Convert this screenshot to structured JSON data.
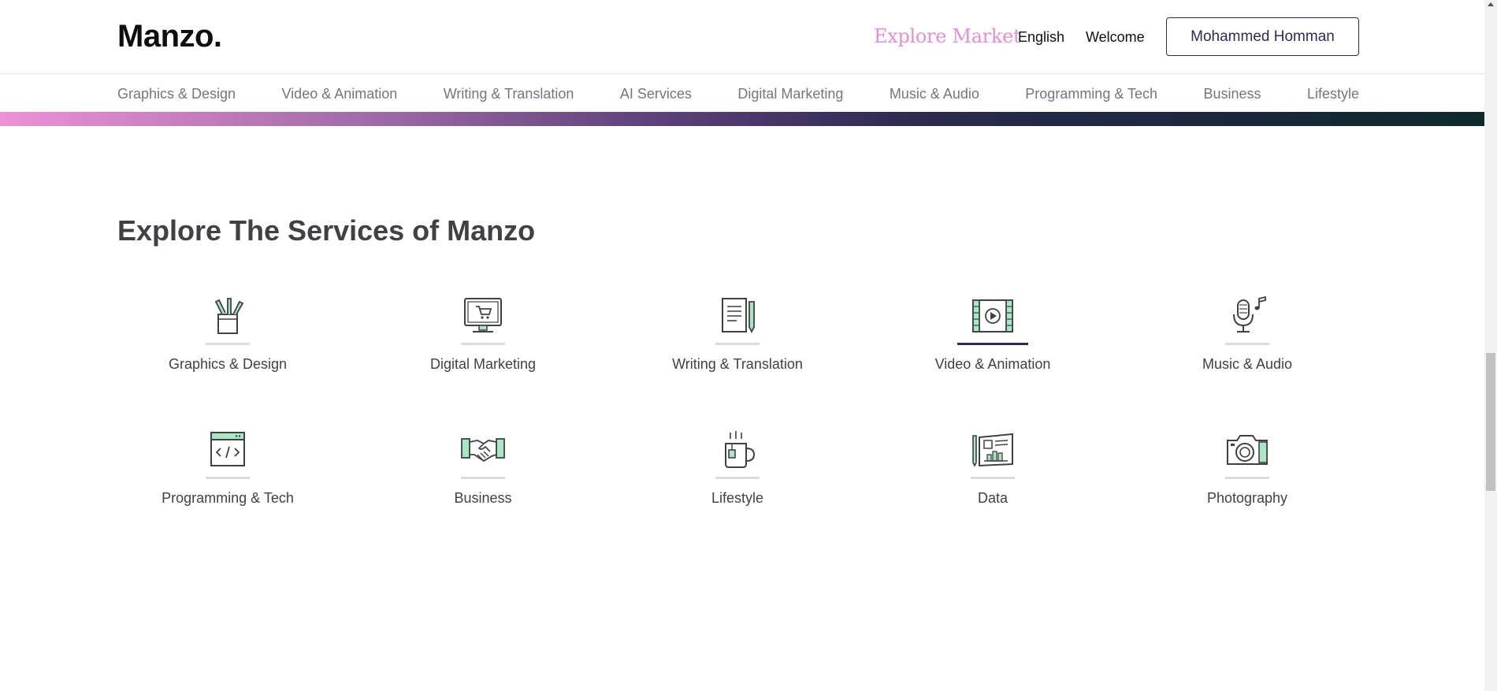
{
  "header": {
    "logo": "Manzo.",
    "explore_market": "Explore Market",
    "language": "English",
    "welcome": "Welcome",
    "user_name": "Mohammed Homman"
  },
  "categories": [
    "Graphics & Design",
    "Video & Animation",
    "Writing & Translation",
    "AI Services",
    "Digital Marketing",
    "Music & Audio",
    "Programming & Tech",
    "Business",
    "Lifestyle"
  ],
  "services_section": {
    "title": "Explore The Services of Manzo",
    "items": [
      {
        "label": "Graphics & Design",
        "icon": "pencil-cup-icon",
        "active": false
      },
      {
        "label": "Digital Marketing",
        "icon": "monitor-cart-icon",
        "active": false
      },
      {
        "label": "Writing & Translation",
        "icon": "document-pen-icon",
        "active": false
      },
      {
        "label": "Video & Animation",
        "icon": "film-play-icon",
        "active": true
      },
      {
        "label": "Music & Audio",
        "icon": "microphone-note-icon",
        "active": false
      },
      {
        "label": "Programming & Tech",
        "icon": "code-window-icon",
        "active": false
      },
      {
        "label": "Business",
        "icon": "handshake-icon",
        "active": false
      },
      {
        "label": "Lifestyle",
        "icon": "tea-mug-icon",
        "active": false
      },
      {
        "label": "Data",
        "icon": "data-chart-icon",
        "active": false
      },
      {
        "label": "Photography",
        "icon": "camera-icon",
        "active": false
      }
    ]
  },
  "colors": {
    "accent_pink": "#e48ed3",
    "brand_dark": "#2e2a5c",
    "icon_green": "#a8e6c4",
    "text_gray": "#74767e"
  }
}
